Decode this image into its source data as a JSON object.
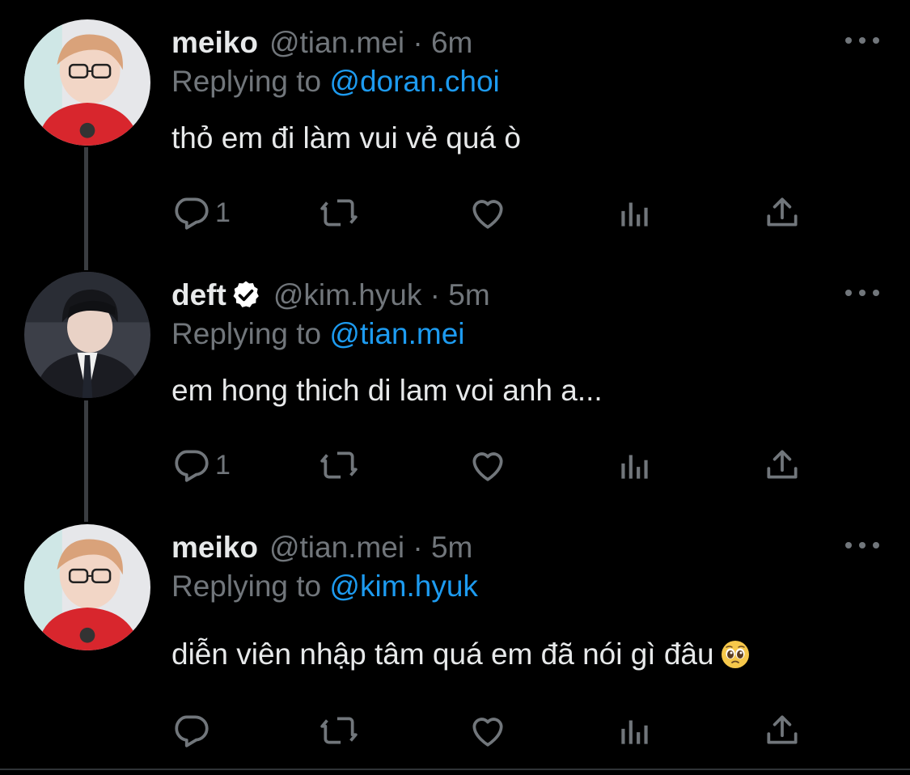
{
  "colors": {
    "background": "#000000",
    "text_primary": "#e7e9ea",
    "text_secondary": "#71767b",
    "link": "#1d9bf0",
    "thread_line": "#3a3d41"
  },
  "tweets": [
    {
      "name": "meiko",
      "handle": "@tian.mei",
      "sep": "·",
      "time": "6m",
      "replying_prefix": "Replying to",
      "replying_handle": "@doran.choi",
      "text": "thỏ em đi làm vui vẻ quá ò",
      "reply_count": "1",
      "verified": false
    },
    {
      "name": "deft",
      "handle": "@kim.hyuk",
      "sep": "·",
      "time": "5m",
      "replying_prefix": "Replying to",
      "replying_handle": "@tian.mei",
      "text": "em hong thich di lam voi anh a...",
      "reply_count": "1",
      "verified": true
    },
    {
      "name": "meiko",
      "handle": "@tian.mei",
      "sep": "·",
      "time": "5m",
      "replying_prefix": "Replying to",
      "replying_handle": "@kim.hyuk",
      "text": "diễn viên nhập tâm quá em đã nói gì đâu",
      "reply_count": "",
      "verified": false,
      "emoji": "pleading-face-icon"
    }
  ]
}
